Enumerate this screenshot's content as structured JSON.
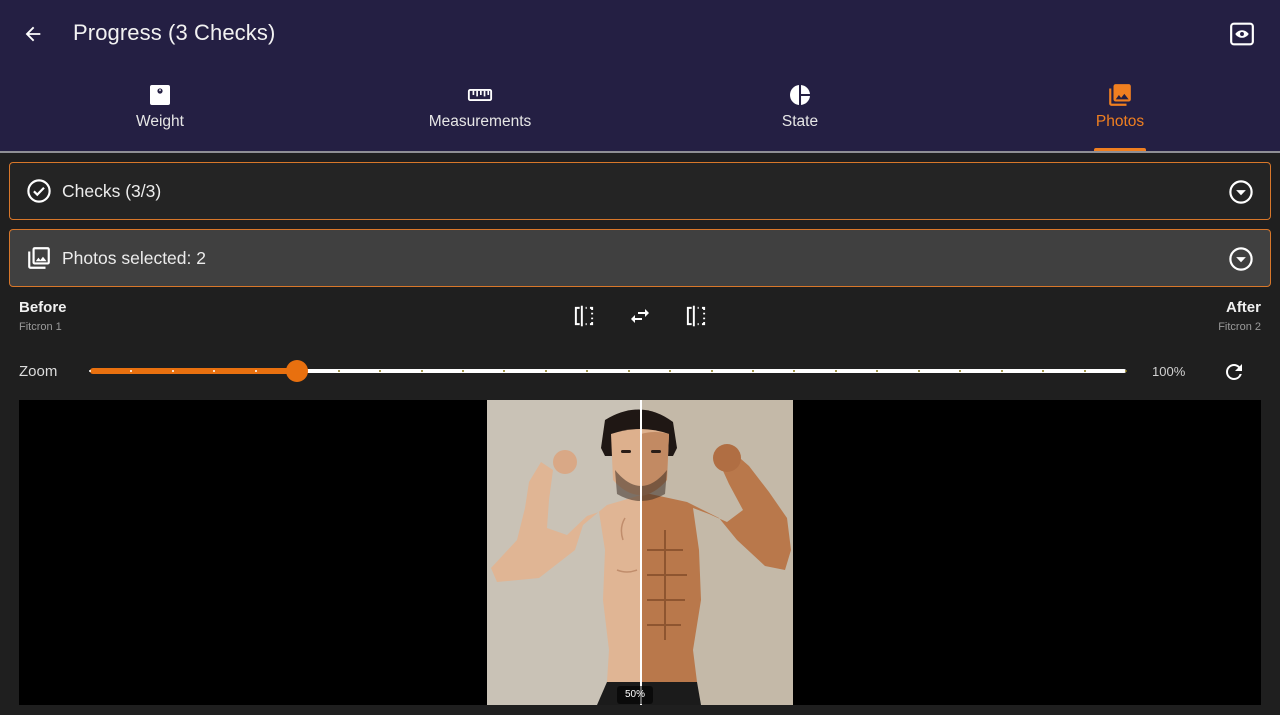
{
  "appbar": {
    "title": "Progress (3 Checks)",
    "back_icon": "arrow-left-icon",
    "eye_icon": "eye-icon",
    "background": "#241f43"
  },
  "tabs": [
    {
      "label": "Weight",
      "icon": "scale-icon",
      "active": false
    },
    {
      "label": "Measurements",
      "icon": "ruler-icon",
      "active": false
    },
    {
      "label": "State",
      "icon": "pie-chart-icon",
      "active": false
    },
    {
      "label": "Photos",
      "icon": "photo-library-icon",
      "active": true
    }
  ],
  "accent_color": "#f07f20",
  "panels": {
    "checks": {
      "label": "Checks (3/3)",
      "icon": "check-circle-icon"
    },
    "photos": {
      "label": "Photos selected: 2",
      "icon": "photo-library-icon"
    }
  },
  "compare": {
    "before_label": "Before",
    "before_sub": "Fitcron 1",
    "after_label": "After",
    "after_sub": "Fitcron 2"
  },
  "zoom": {
    "label": "Zoom",
    "value_text": "100%",
    "slider_fraction": 0.2
  },
  "viewer": {
    "split_text": "50%",
    "split_fraction": 0.5
  }
}
